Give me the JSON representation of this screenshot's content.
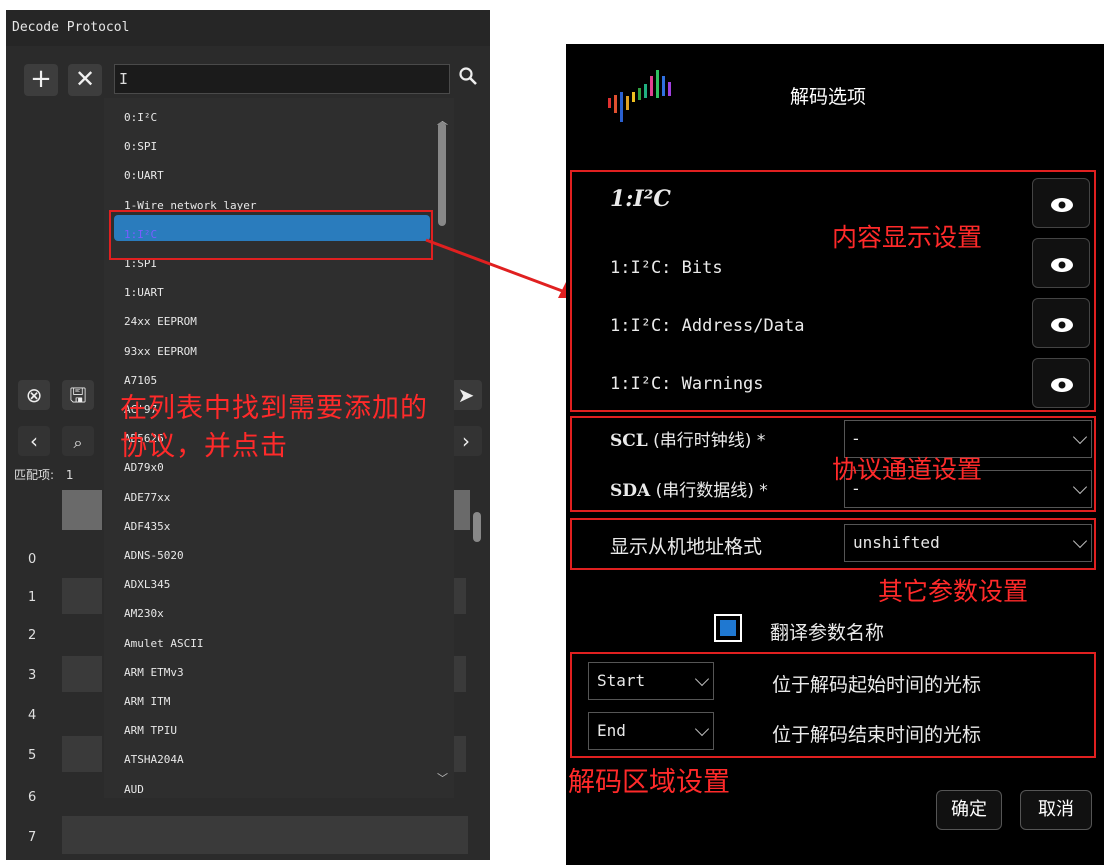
{
  "left_panel": {
    "title": "Decode Protocol",
    "search_value": "I",
    "protocols": [
      "0:I²C",
      "0:SPI",
      "0:UART",
      "1-Wire network layer",
      "1:I²C",
      "1:SPI",
      "1:UART",
      "24xx EEPROM",
      "93xx EEPROM",
      "A7105",
      "AC'97",
      "AD5626",
      "AD79x0",
      "ADE77xx",
      "ADF435x",
      "ADNS-5020",
      "ADXL345",
      "AM230x",
      "Amulet ASCII",
      "ARM ETMv3",
      "ARM ITM",
      "ARM TPIU",
      "ATSHA204A",
      "AUD"
    ],
    "match_label": "匹配项:",
    "match_count": "1",
    "row_numbers": [
      "0",
      "1",
      "2",
      "3",
      "4",
      "5",
      "6",
      "7"
    ],
    "annotation": "在列表中找到需要添加的协议，并点击"
  },
  "dialog": {
    "title": "解码选项",
    "content_rows": [
      {
        "label": "1:I²C",
        "emphasis": true
      },
      {
        "label": "1:I²C: Bits",
        "emphasis": false
      },
      {
        "label": "1:I²C: Address/Data",
        "emphasis": false
      },
      {
        "label": "1:I²C: Warnings",
        "emphasis": false
      }
    ],
    "annotation_content": "内容显示设置",
    "channels": [
      {
        "name": "SCL",
        "desc": "(串行时钟线)",
        "required": "*",
        "value": "-"
      },
      {
        "name": "SDA",
        "desc": "(串行数据线)",
        "required": "*",
        "value": "-"
      }
    ],
    "annotation_channel": "协议通道设置",
    "slave_label": "显示从机地址格式",
    "slave_value": "unshifted",
    "annotation_other": "其它参数设置",
    "translate_label": "翻译参数名称",
    "translate_checked": true,
    "start_value": "Start",
    "start_label": "位于解码起始时间的光标",
    "end_value": "End",
    "end_label": "位于解码结束时间的光标",
    "annotation_region": "解码区域设置",
    "ok_label": "确定",
    "cancel_label": "取消"
  },
  "colors": {
    "annotation_red": "#e02020",
    "highlight_blue": "#2a7cbd",
    "checkbox_blue": "#1f78d1"
  }
}
